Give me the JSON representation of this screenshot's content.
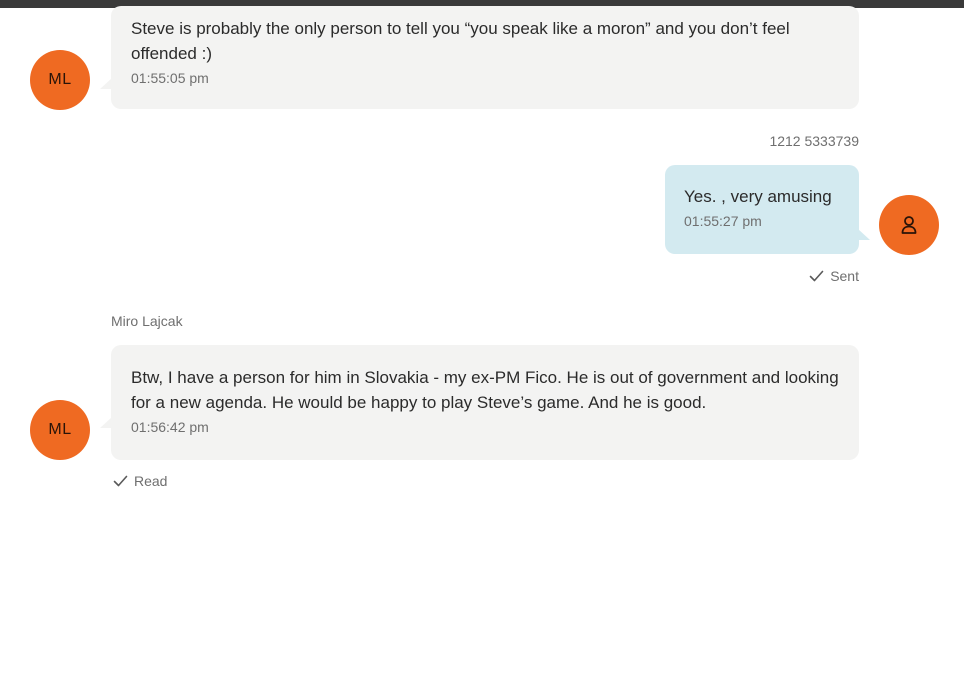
{
  "messages": [
    {
      "direction": "incoming",
      "avatar_initials": "ML",
      "text": "Steve is probably the only person to tell you “you speak like a moron” and you don’t feel offended :)",
      "time": "01:55:05 pm"
    },
    {
      "direction": "outgoing",
      "sender_label": "1212 5333739",
      "avatar_icon": "user-icon",
      "text": "Yes. , very amusing",
      "time": "01:55:27 pm",
      "status": "Sent"
    },
    {
      "direction": "incoming",
      "sender_label": "Miro Lajcak",
      "avatar_initials": "ML",
      "text": "Btw, I have a person for him in Slovakia - my ex-PM Fico. He is out of government and looking for a new agenda. He would be happy to play Steve’s game. And he is good.",
      "time": "01:56:42 pm",
      "status": "Read"
    }
  ],
  "colors": {
    "avatar": "#ef6a22",
    "incoming_bubble": "#f3f3f2",
    "outgoing_bubble": "#d3eaf0",
    "top_bar": "#3a3a3a"
  }
}
